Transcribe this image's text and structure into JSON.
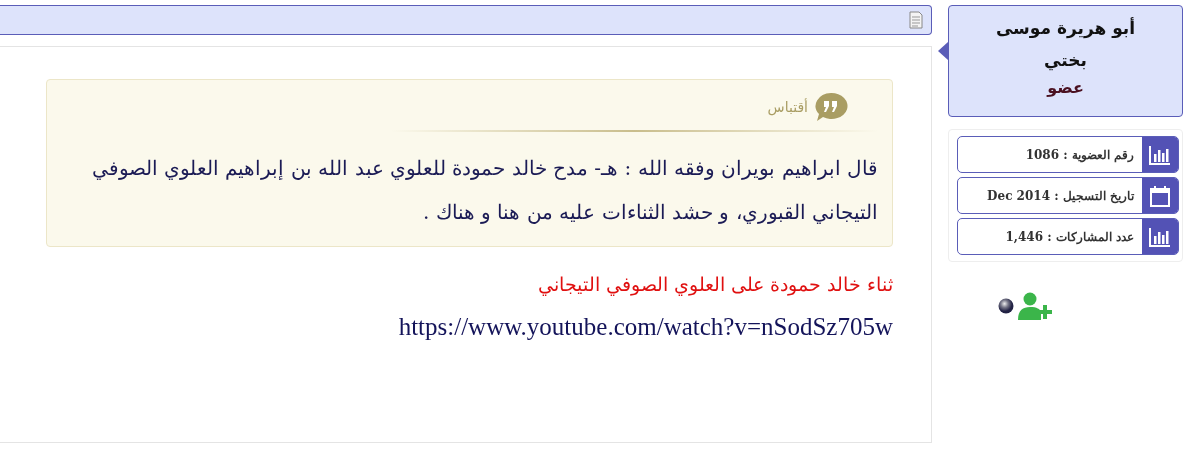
{
  "profile": {
    "name": "أبو هريرة موسى بختي",
    "role": "عضو"
  },
  "stats": [
    {
      "kind": "chart",
      "text": "رقم العضوية : 1086"
    },
    {
      "kind": "calendar",
      "text": "تاريخ التسجيل : Dec 2014"
    },
    {
      "kind": "chart",
      "text": "عدد المشاركات : 1,446"
    }
  ],
  "post": {
    "quote": {
      "label": "أقتباس",
      "text": "قال ابراهيم بويران وفقه الله : هـ- مدح خالد حمودة للعلوي عبد الله بن إبراهيم العلوي الصوفي التيجاني القبوري، و حشد الثناءات عليه من هنا و هناك ."
    },
    "title": "ثناء خالد حمودة على العلوي الصوفي التيجاني",
    "link": "https://www.youtube.com/watch?v=nSodSz705w"
  }
}
